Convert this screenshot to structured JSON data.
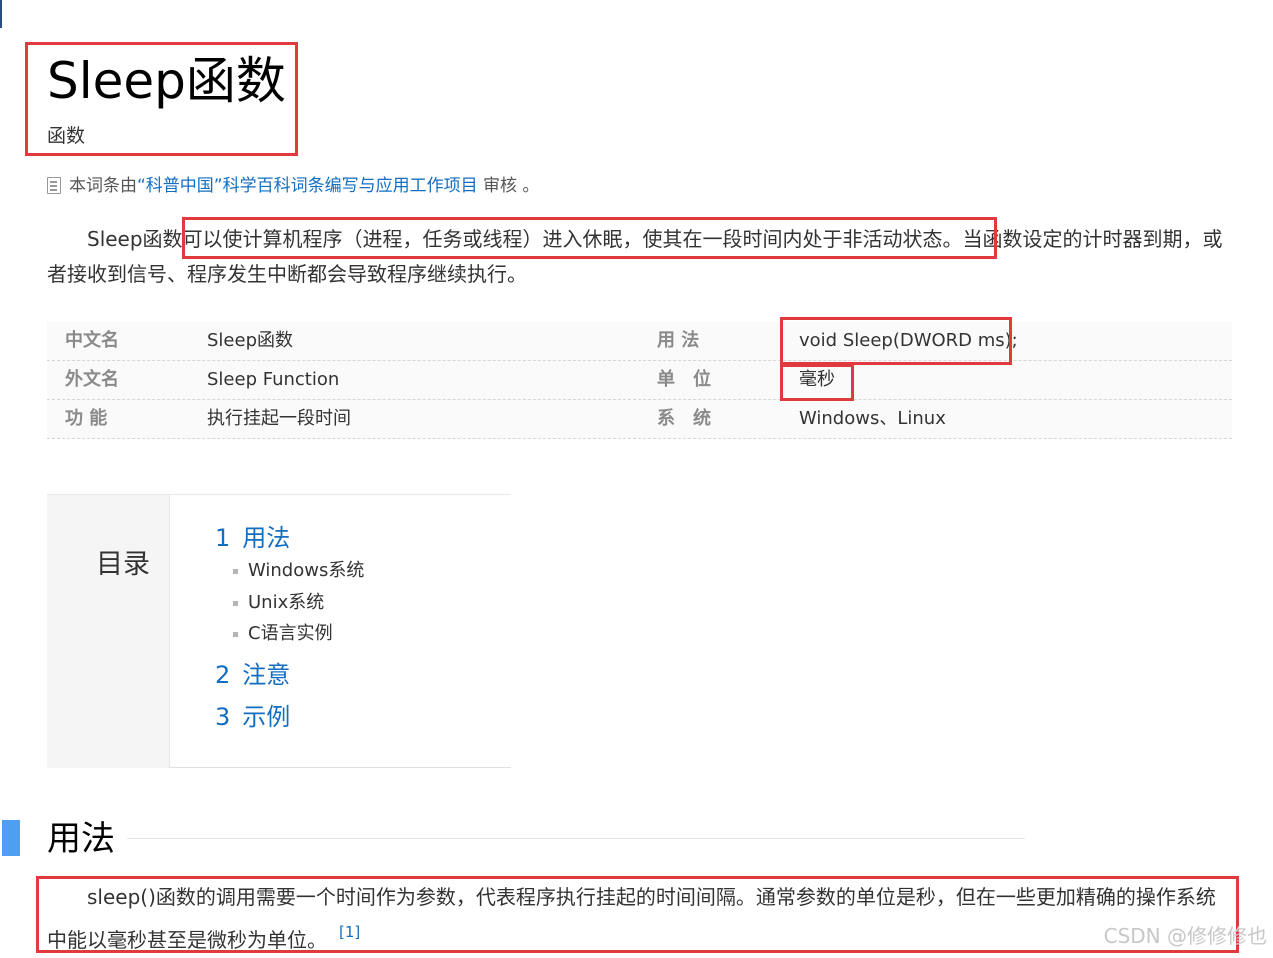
{
  "header": {
    "title": "Sleep函数",
    "subtitle": "函数"
  },
  "review_note": {
    "prefix": "本词条由",
    "link": "“科普中国”科学百科词条编写与应用工作项目",
    "suffix": " 审核 。"
  },
  "intro": {
    "lead": "Sleep函数",
    "highlight": "可以使计算机程序（进程，任务或线程）进入休眠，使其在一段时间内处于非活动状态。",
    "rest": "当函数设定的计时器到期，或者接收到信号、程序发生中断都会导致程序继续执行。"
  },
  "info_table": {
    "rows": [
      {
        "key1": "中文名",
        "val1": "Sleep函数",
        "key2": "用 法",
        "val2": "void Sleep(DWORD ms);"
      },
      {
        "key1": "外文名",
        "val1": "Sleep Function",
        "key2": "单　位",
        "val2": "毫秒"
      },
      {
        "key1": "功 能",
        "val1": "执行挂起一段时间",
        "key2": "系　统",
        "val2": "Windows、Linux"
      }
    ]
  },
  "toc": {
    "heading": "目录",
    "items": [
      {
        "num": "1",
        "label": "用法"
      },
      {
        "num": "2",
        "label": "注意"
      },
      {
        "num": "3",
        "label": "示例"
      }
    ],
    "subitems": [
      "Windows系统",
      "Unix系统",
      "C语言实例"
    ]
  },
  "section": {
    "title": "用法",
    "para": "sleep()函数的调用需要一个时间作为参数，代表程序执行挂起的时间间隔。通常参数的单位是秒，但在一些更加精确的操作系统中能以毫秒甚至是微秒为单位。",
    "ref": "[1]"
  },
  "watermark": "CSDN @修修修也",
  "colors": {
    "link": "#136ec2",
    "annotation_red": "#e03a3e",
    "section_accent": "#4e9ff1"
  }
}
